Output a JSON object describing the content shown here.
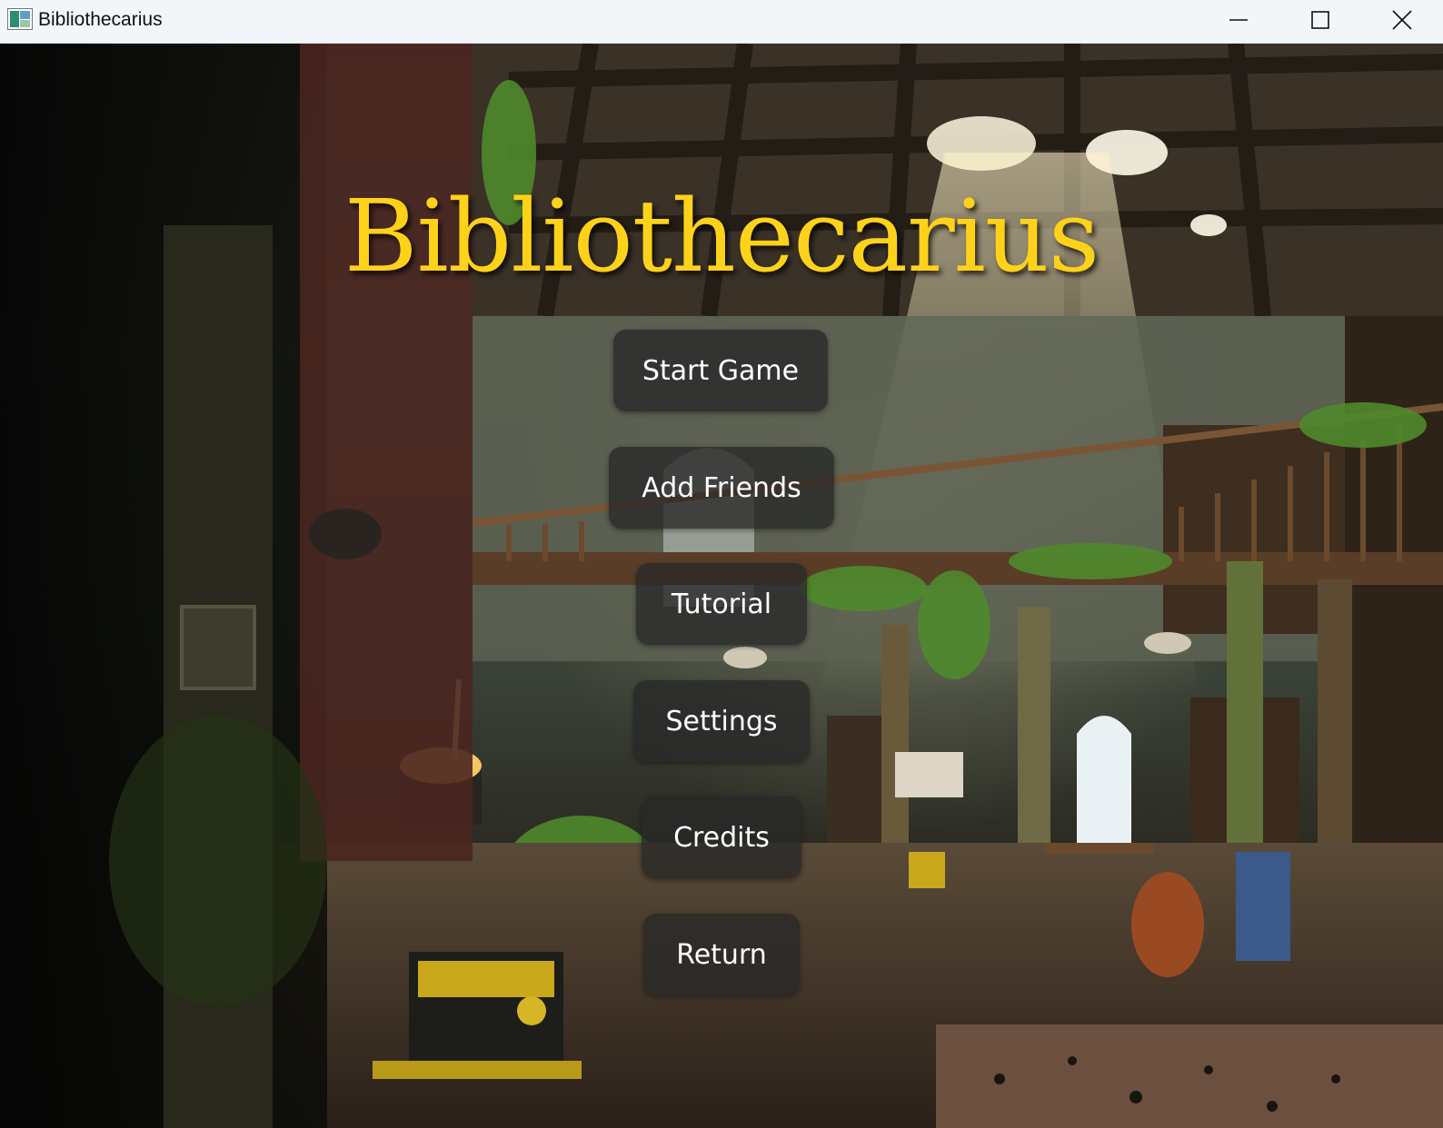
{
  "window": {
    "title": "Bibliothecarius",
    "icon": "app-window-icon",
    "controls": [
      "minimize-icon",
      "maximize-icon",
      "close-icon"
    ]
  },
  "game": {
    "title": "Bibliothecarius",
    "title_color": "#ffd21a"
  },
  "menu": {
    "start_game": "Start Game",
    "add_friends": "Add Friends",
    "tutorial": "Tutorial",
    "settings": "Settings",
    "credits": "Credits",
    "return": "Return"
  },
  "colors": {
    "button_bg": "rgba(40,40,40,0.78)",
    "button_text": "#ffffff",
    "titlebar_bg": "#f3f6f9"
  }
}
